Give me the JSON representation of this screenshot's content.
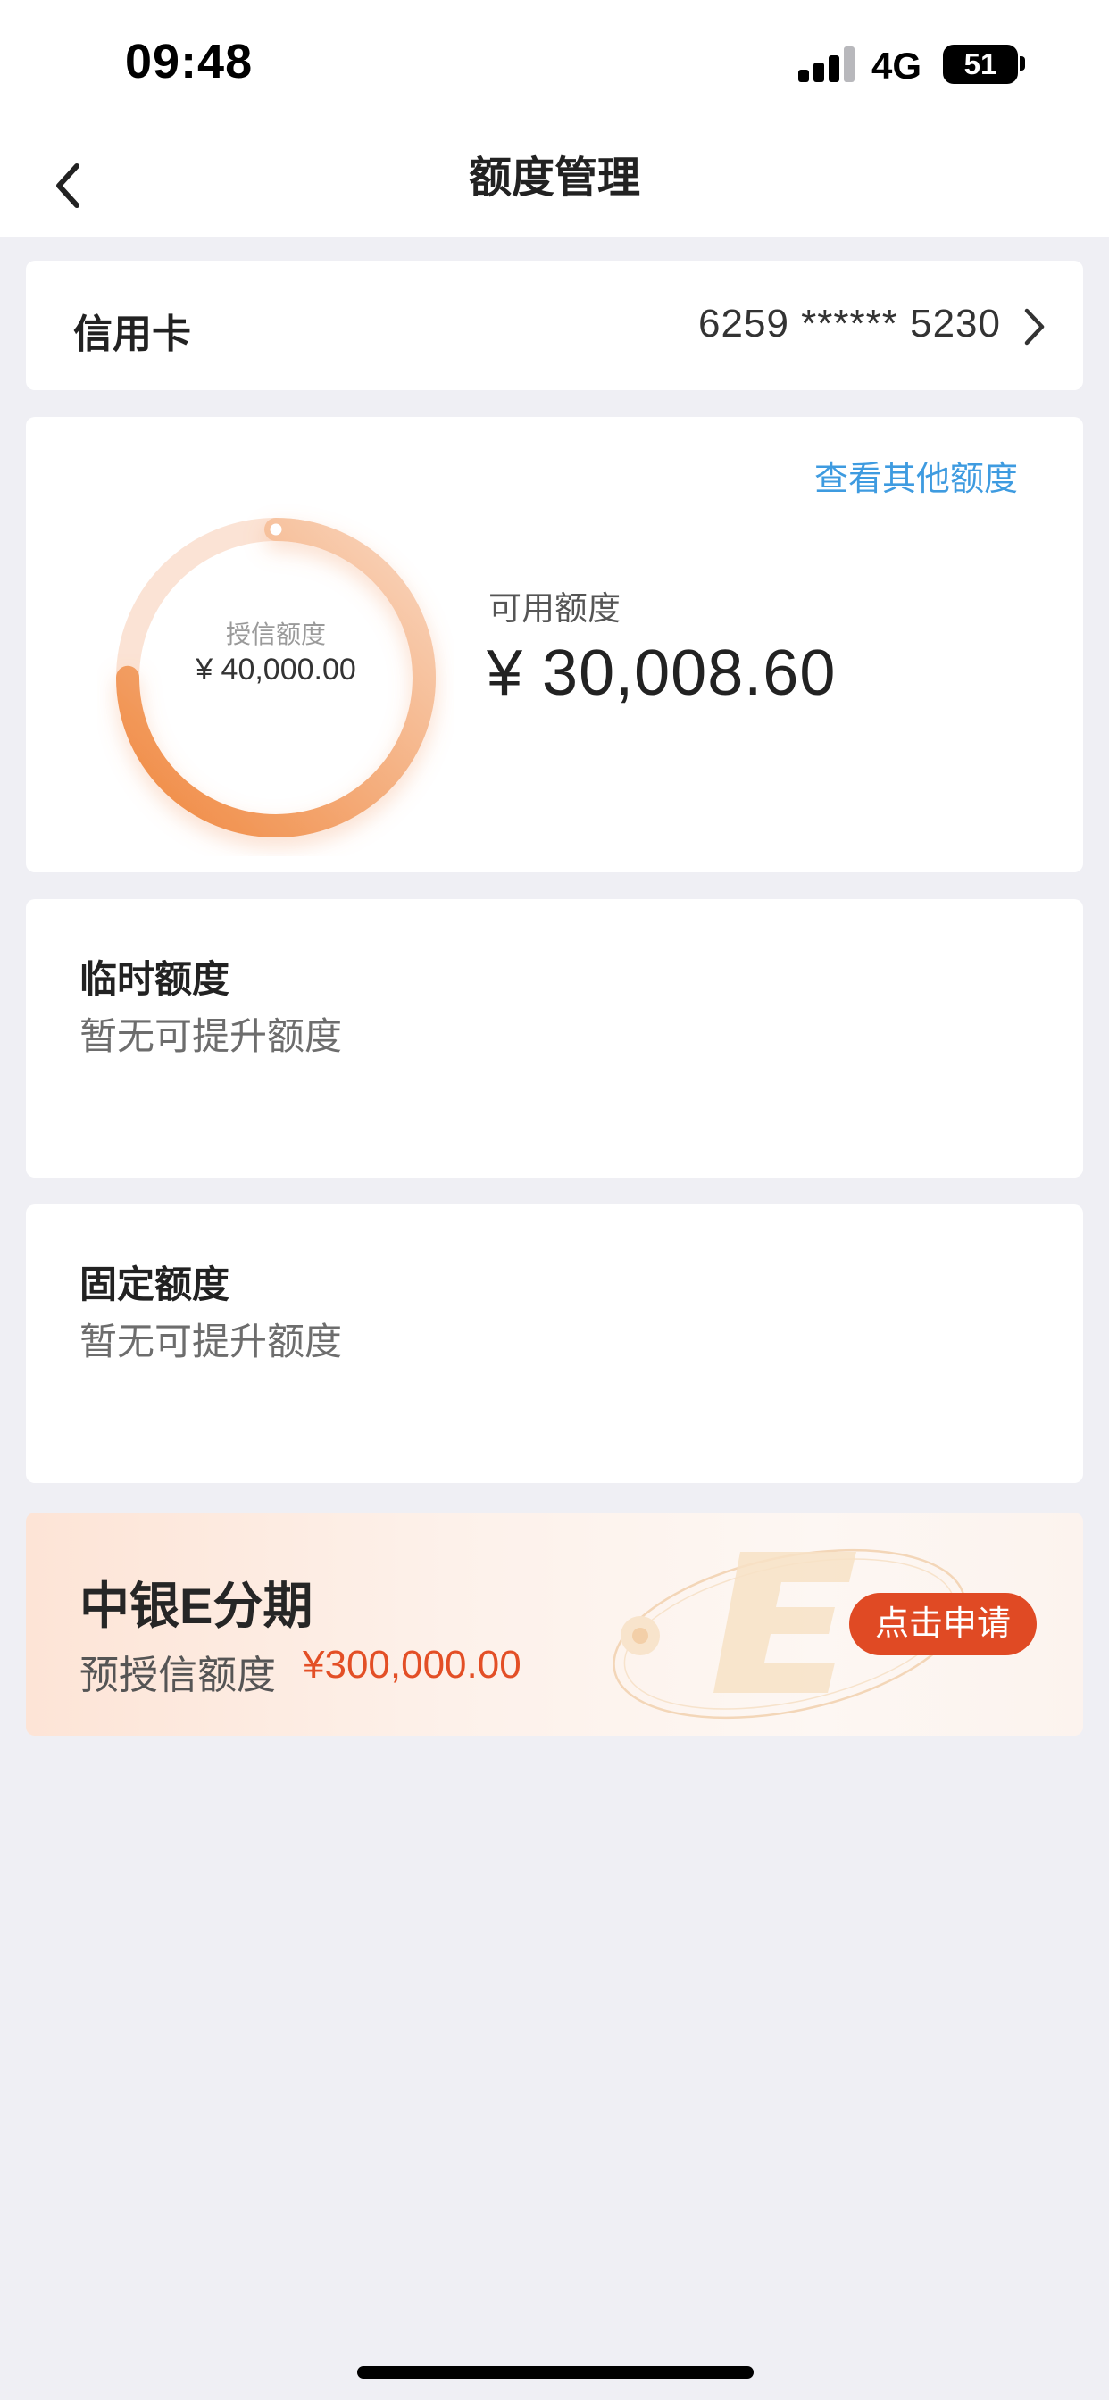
{
  "status_bar": {
    "time": "09:48",
    "network": "4G",
    "battery": "51"
  },
  "nav": {
    "title": "额度管理",
    "back_icon": "chevron-left-icon"
  },
  "card_row": {
    "label": "信用卡",
    "number": "6259 ****** 5230",
    "chevron_icon": "chevron-right-icon"
  },
  "limit": {
    "other_link": "查看其他额度",
    "credit_label": "授信额度",
    "credit_amount": "¥ 40,000.00",
    "available_label": "可用额度",
    "available_amount": "¥ 30,008.60",
    "available_ratio": 0.7502,
    "ring_colors": {
      "track": "#fbe3d5",
      "start": "#f0883f",
      "end": "#f9d6bf"
    }
  },
  "temporary": {
    "title": "临时额度",
    "subtitle": "暂无可提升额度"
  },
  "fixed": {
    "title": "固定额度",
    "subtitle": "暂无可提升额度"
  },
  "promo": {
    "title": "中银E分期",
    "subtitle": "预授信额度",
    "amount": "¥300,000.00",
    "button": "点击申请",
    "accent": "#e04a24"
  },
  "colors": {
    "link": "#3e9be0",
    "background": "#efeff4"
  }
}
